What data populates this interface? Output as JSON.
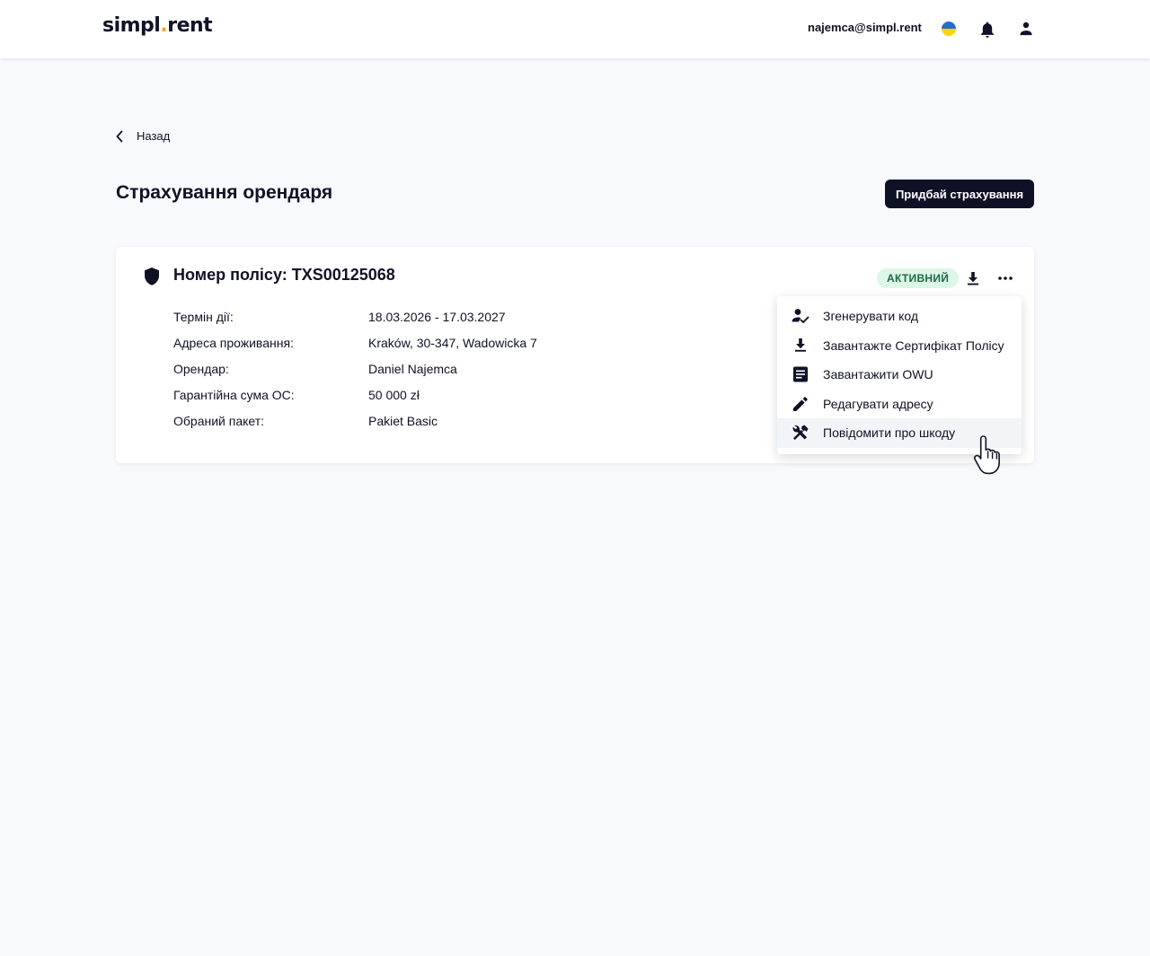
{
  "header": {
    "logo_part1": "simpl",
    "logo_dot": ".",
    "logo_part2": "rent",
    "user_email": "najemca@simpl.rent",
    "language_flag": "ukraine-flag-icon"
  },
  "nav": {
    "back_label": "Назад"
  },
  "page": {
    "title": "Страхування орендаря",
    "buy_button_label": "Придбай страхування"
  },
  "policy": {
    "title": "Номер полісу: TXS00125068",
    "status": "АКТИВНИЙ",
    "details": [
      {
        "label": "Термін дії:",
        "value": "18.03.2026 - 17.03.2027"
      },
      {
        "label": "Адреса проживання:",
        "value": "Kraków, 30-347, Wadowicka 7"
      },
      {
        "label": "Орендар:",
        "value": "Daniel Najemca"
      },
      {
        "label": "Гарантійна сума ОС:",
        "value": "50 000 zł"
      },
      {
        "label": "Обраний пакет:",
        "value": "Pakiet Basic"
      }
    ]
  },
  "menu": {
    "items": [
      {
        "label": "Згенерувати код",
        "icon": "person-check-icon"
      },
      {
        "label": "Завантажте Сертифікат Полісу",
        "icon": "download-icon"
      },
      {
        "label": "Завантажити OWU",
        "icon": "document-icon"
      },
      {
        "label": "Редагувати адресу",
        "icon": "pencil-icon"
      },
      {
        "label": "Повідомити про шкоду",
        "icon": "tools-icon"
      }
    ]
  },
  "colors": {
    "brand_dark": "#0f1225",
    "logo_dot": "#f5a623",
    "status_bg": "#dcf7e8",
    "status_text": "#1d6a43",
    "page_bg": "#f8f9fd"
  }
}
